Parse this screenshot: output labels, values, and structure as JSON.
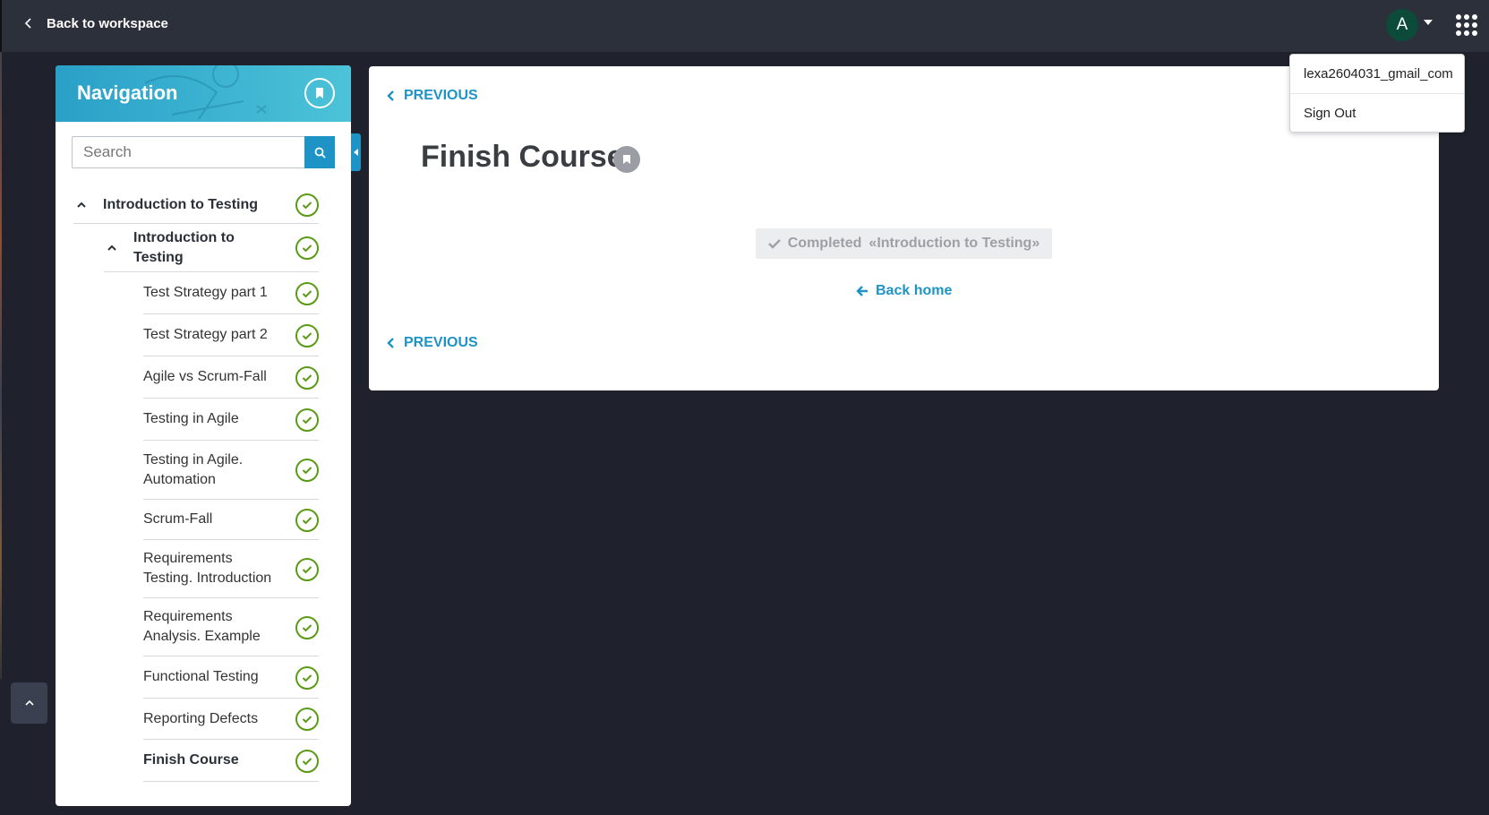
{
  "topbar": {
    "back_label": "Back to workspace",
    "avatar_initial": "A"
  },
  "user_menu": {
    "username": "lexa2604031_gmail_com",
    "sign_out": "Sign Out"
  },
  "navigation": {
    "title": "Navigation",
    "search_placeholder": "Search",
    "items": [
      {
        "label": "Introduction to Testing",
        "level": 0,
        "expanded": true,
        "completed": true
      },
      {
        "label": "Introduction to Testing",
        "level": 1,
        "expanded": true,
        "completed": true
      },
      {
        "label": "Test Strategy part 1",
        "level": 2,
        "completed": true
      },
      {
        "label": "Test Strategy part 2",
        "level": 2,
        "completed": true
      },
      {
        "label": "Agile vs Scrum-Fall",
        "level": 2,
        "completed": true
      },
      {
        "label": "Testing in Agile",
        "level": 2,
        "completed": true
      },
      {
        "label": "Testing in Agile. Automation",
        "level": 2,
        "completed": true
      },
      {
        "label": "Scrum-Fall",
        "level": 2,
        "completed": true
      },
      {
        "label": "Requirements Testing. Introduction",
        "level": 2,
        "completed": true
      },
      {
        "label": "Requirements Analysis. Example",
        "level": 2,
        "completed": true
      },
      {
        "label": "Functional Testing",
        "level": 2,
        "completed": true
      },
      {
        "label": "Reporting Defects",
        "level": 2,
        "completed": true
      },
      {
        "label": "Finish Course",
        "level": 2,
        "completed": true,
        "active": true
      }
    ]
  },
  "main": {
    "previous_top": "PREVIOUS",
    "title": "Finish Course",
    "completed_text": "Completed",
    "completed_course": "«Introduction to Testing»",
    "back_home": "Back home",
    "previous_bottom": "PREVIOUS"
  },
  "colors": {
    "accent": "#1e93c6",
    "check": "#5a9a16",
    "background": "#1f222c",
    "topbar": "#2c303b"
  }
}
